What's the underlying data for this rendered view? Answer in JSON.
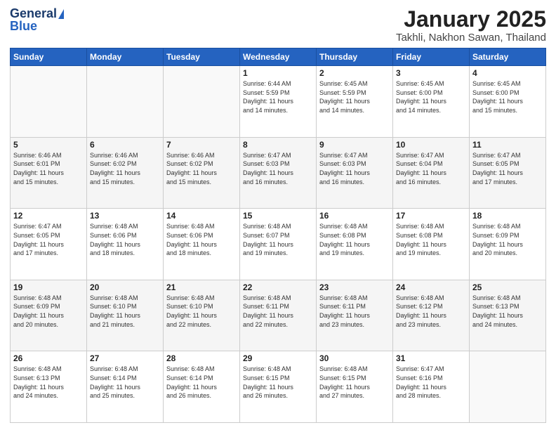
{
  "logo": {
    "line1": "General",
    "line2": "Blue"
  },
  "header": {
    "title": "January 2025",
    "subtitle": "Takhli, Nakhon Sawan, Thailand"
  },
  "weekdays": [
    "Sunday",
    "Monday",
    "Tuesday",
    "Wednesday",
    "Thursday",
    "Friday",
    "Saturday"
  ],
  "weeks": [
    [
      {
        "day": "",
        "info": ""
      },
      {
        "day": "",
        "info": ""
      },
      {
        "day": "",
        "info": ""
      },
      {
        "day": "1",
        "info": "Sunrise: 6:44 AM\nSunset: 5:59 PM\nDaylight: 11 hours\nand 14 minutes."
      },
      {
        "day": "2",
        "info": "Sunrise: 6:45 AM\nSunset: 5:59 PM\nDaylight: 11 hours\nand 14 minutes."
      },
      {
        "day": "3",
        "info": "Sunrise: 6:45 AM\nSunset: 6:00 PM\nDaylight: 11 hours\nand 14 minutes."
      },
      {
        "day": "4",
        "info": "Sunrise: 6:45 AM\nSunset: 6:00 PM\nDaylight: 11 hours\nand 15 minutes."
      }
    ],
    [
      {
        "day": "5",
        "info": "Sunrise: 6:46 AM\nSunset: 6:01 PM\nDaylight: 11 hours\nand 15 minutes."
      },
      {
        "day": "6",
        "info": "Sunrise: 6:46 AM\nSunset: 6:02 PM\nDaylight: 11 hours\nand 15 minutes."
      },
      {
        "day": "7",
        "info": "Sunrise: 6:46 AM\nSunset: 6:02 PM\nDaylight: 11 hours\nand 15 minutes."
      },
      {
        "day": "8",
        "info": "Sunrise: 6:47 AM\nSunset: 6:03 PM\nDaylight: 11 hours\nand 16 minutes."
      },
      {
        "day": "9",
        "info": "Sunrise: 6:47 AM\nSunset: 6:03 PM\nDaylight: 11 hours\nand 16 minutes."
      },
      {
        "day": "10",
        "info": "Sunrise: 6:47 AM\nSunset: 6:04 PM\nDaylight: 11 hours\nand 16 minutes."
      },
      {
        "day": "11",
        "info": "Sunrise: 6:47 AM\nSunset: 6:05 PM\nDaylight: 11 hours\nand 17 minutes."
      }
    ],
    [
      {
        "day": "12",
        "info": "Sunrise: 6:47 AM\nSunset: 6:05 PM\nDaylight: 11 hours\nand 17 minutes."
      },
      {
        "day": "13",
        "info": "Sunrise: 6:48 AM\nSunset: 6:06 PM\nDaylight: 11 hours\nand 18 minutes."
      },
      {
        "day": "14",
        "info": "Sunrise: 6:48 AM\nSunset: 6:06 PM\nDaylight: 11 hours\nand 18 minutes."
      },
      {
        "day": "15",
        "info": "Sunrise: 6:48 AM\nSunset: 6:07 PM\nDaylight: 11 hours\nand 19 minutes."
      },
      {
        "day": "16",
        "info": "Sunrise: 6:48 AM\nSunset: 6:08 PM\nDaylight: 11 hours\nand 19 minutes."
      },
      {
        "day": "17",
        "info": "Sunrise: 6:48 AM\nSunset: 6:08 PM\nDaylight: 11 hours\nand 19 minutes."
      },
      {
        "day": "18",
        "info": "Sunrise: 6:48 AM\nSunset: 6:09 PM\nDaylight: 11 hours\nand 20 minutes."
      }
    ],
    [
      {
        "day": "19",
        "info": "Sunrise: 6:48 AM\nSunset: 6:09 PM\nDaylight: 11 hours\nand 20 minutes."
      },
      {
        "day": "20",
        "info": "Sunrise: 6:48 AM\nSunset: 6:10 PM\nDaylight: 11 hours\nand 21 minutes."
      },
      {
        "day": "21",
        "info": "Sunrise: 6:48 AM\nSunset: 6:10 PM\nDaylight: 11 hours\nand 22 minutes."
      },
      {
        "day": "22",
        "info": "Sunrise: 6:48 AM\nSunset: 6:11 PM\nDaylight: 11 hours\nand 22 minutes."
      },
      {
        "day": "23",
        "info": "Sunrise: 6:48 AM\nSunset: 6:11 PM\nDaylight: 11 hours\nand 23 minutes."
      },
      {
        "day": "24",
        "info": "Sunrise: 6:48 AM\nSunset: 6:12 PM\nDaylight: 11 hours\nand 23 minutes."
      },
      {
        "day": "25",
        "info": "Sunrise: 6:48 AM\nSunset: 6:13 PM\nDaylight: 11 hours\nand 24 minutes."
      }
    ],
    [
      {
        "day": "26",
        "info": "Sunrise: 6:48 AM\nSunset: 6:13 PM\nDaylight: 11 hours\nand 24 minutes."
      },
      {
        "day": "27",
        "info": "Sunrise: 6:48 AM\nSunset: 6:14 PM\nDaylight: 11 hours\nand 25 minutes."
      },
      {
        "day": "28",
        "info": "Sunrise: 6:48 AM\nSunset: 6:14 PM\nDaylight: 11 hours\nand 26 minutes."
      },
      {
        "day": "29",
        "info": "Sunrise: 6:48 AM\nSunset: 6:15 PM\nDaylight: 11 hours\nand 26 minutes."
      },
      {
        "day": "30",
        "info": "Sunrise: 6:48 AM\nSunset: 6:15 PM\nDaylight: 11 hours\nand 27 minutes."
      },
      {
        "day": "31",
        "info": "Sunrise: 6:47 AM\nSunset: 6:16 PM\nDaylight: 11 hours\nand 28 minutes."
      },
      {
        "day": "",
        "info": ""
      }
    ]
  ]
}
